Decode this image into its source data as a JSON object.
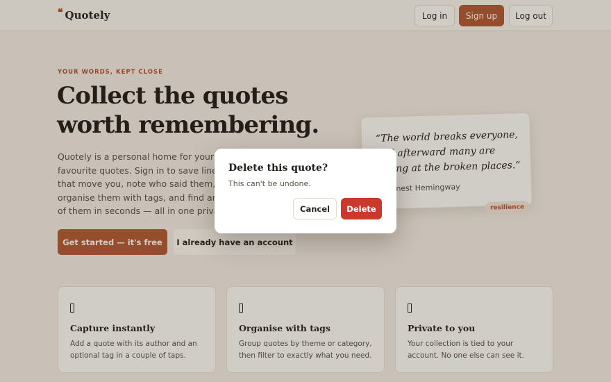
{
  "header": {
    "logo_mark": "❝",
    "logo_text": "Quotely",
    "login": "Log in",
    "signup": "Sign up",
    "logout": "Log out"
  },
  "hero": {
    "eyebrow": "YOUR WORDS, KEPT CLOSE",
    "headline_1": "Collect the quotes",
    "headline_2": "worth remembering.",
    "lede": "Quotely is a personal home for your favourite quotes. Sign in to save lines that move you, note who said them, organise them with tags, and find any of them in seconds — all in one private place.",
    "cta_primary": "Get started — it's free",
    "cta_secondary": "I already have an account"
  },
  "quote_card": {
    "text": "“The world breaks everyone, and afterward many are strong at the broken places.”",
    "author": "Ernest Hemingway",
    "tag": "resilience"
  },
  "features": [
    {
      "title": "Capture instantly",
      "desc": "Add a quote with its author and an optional tag in a couple of taps."
    },
    {
      "title": "Organise with tags",
      "desc": "Group quotes by theme or category, then filter to exactly what you need."
    },
    {
      "title": "Private to you",
      "desc": "Your collection is tied to your account. No one else can see it."
    }
  ],
  "modal": {
    "title": "Delete this quote?",
    "text": "This can't be undone.",
    "cancel": "Cancel",
    "delete": "Delete"
  },
  "colors": {
    "accent": "#b45a32",
    "danger": "#c83a2e",
    "background": "#f6efe6"
  }
}
